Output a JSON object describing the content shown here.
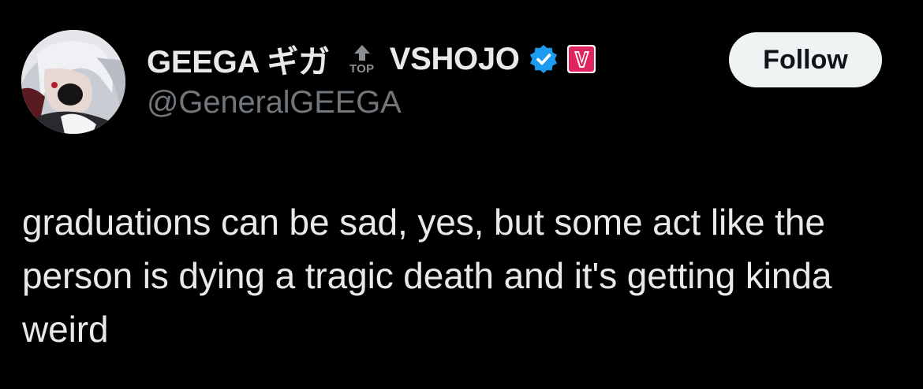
{
  "author": {
    "display_name": "GEEGA ギガ",
    "top_badge_text": "TOP",
    "affiliation": "VSHOJO",
    "handle": "@GeneralGEEGA",
    "verified_color": "#1d9bf0",
    "affiliation_badge_color": "#e0245e",
    "affiliation_badge_letter": "V"
  },
  "follow_button": {
    "label": "Follow"
  },
  "tweet": {
    "text": "graduations can be sad, yes, but some act like the person is dying a tragic death and it's getting kinda weird"
  },
  "icons": {
    "top_badge": "arrow-up-icon",
    "verified": "verified-check-icon",
    "affiliation": "vshojo-logo-icon"
  }
}
